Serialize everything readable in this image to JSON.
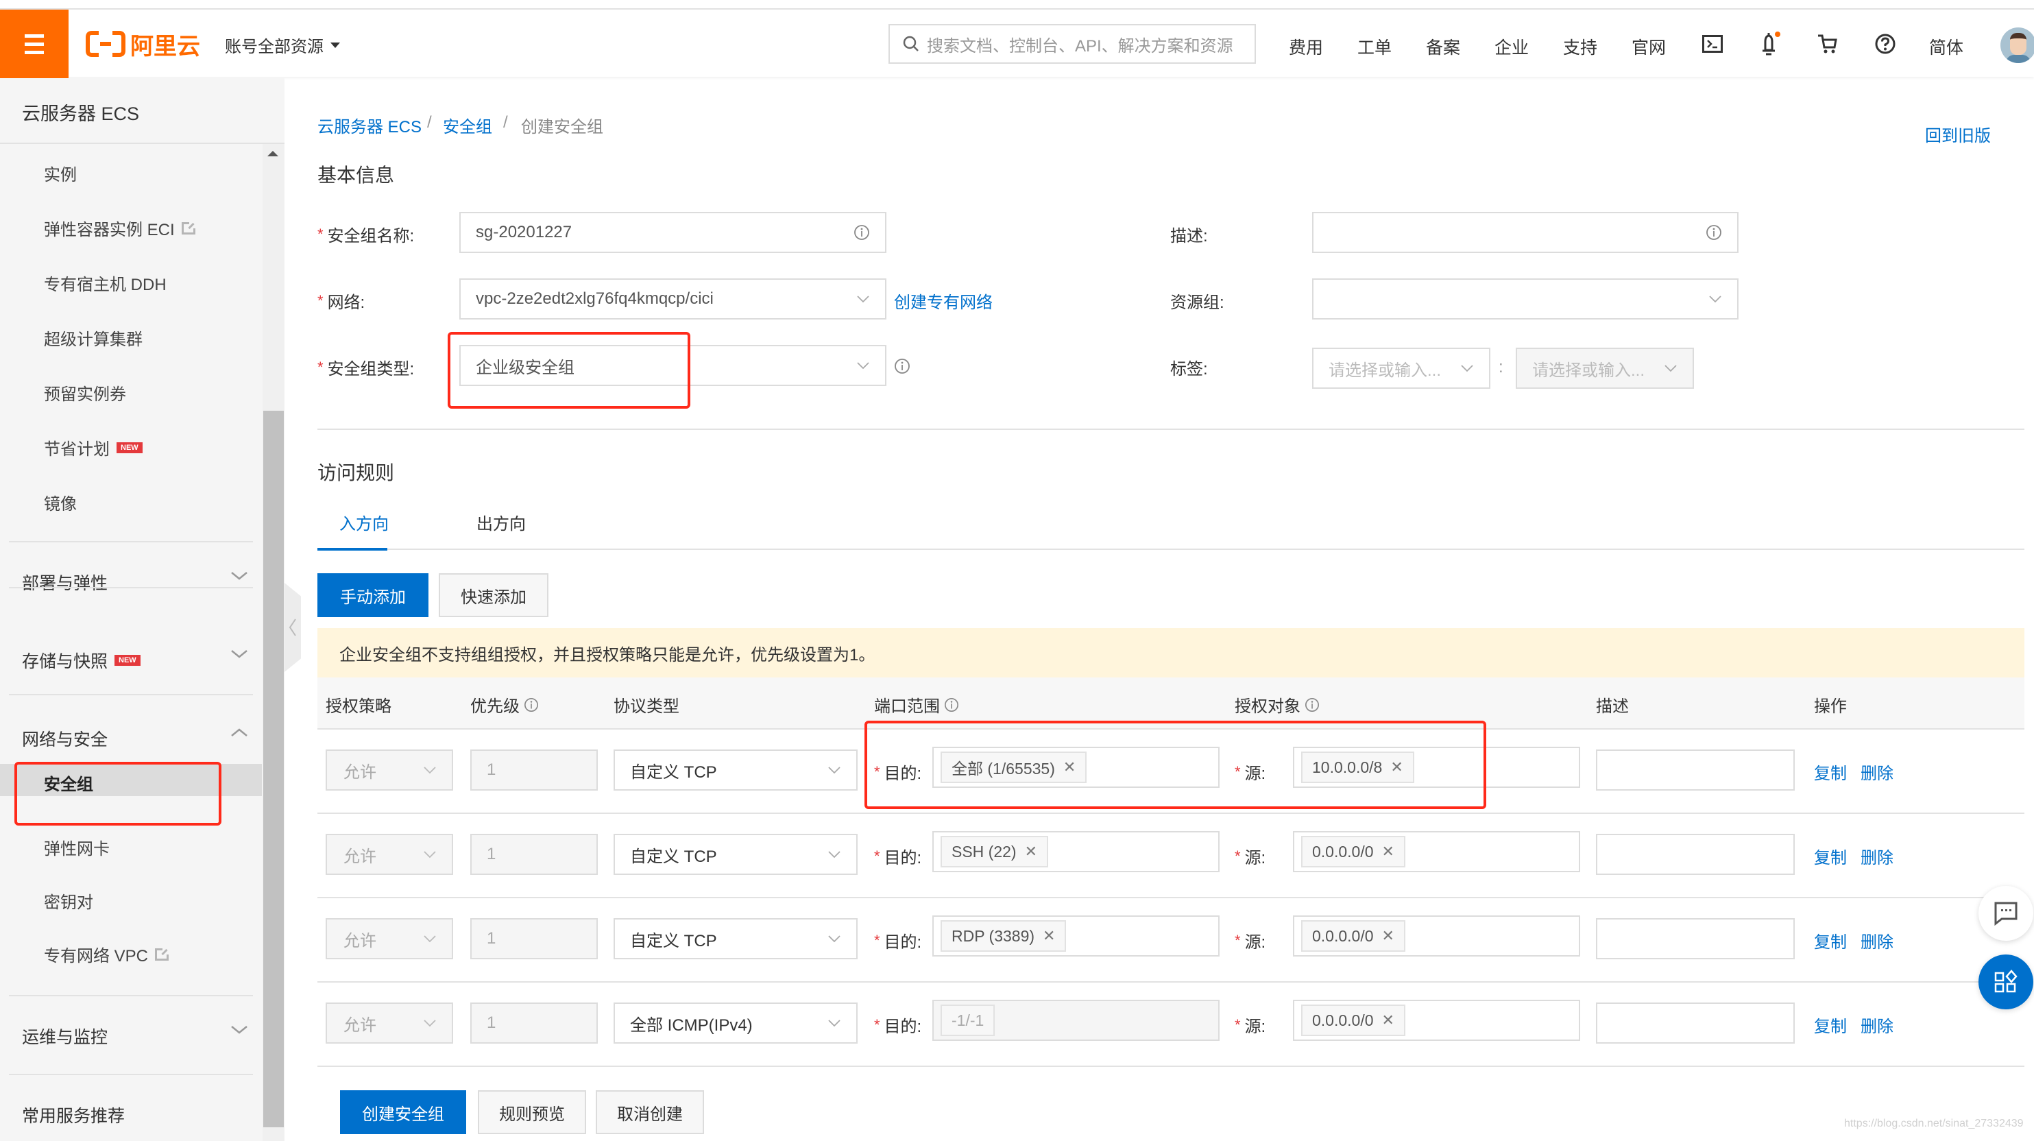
{
  "topbar": {
    "brand": "阿里云",
    "account_label": "账号全部资源",
    "search_placeholder": "搜索文档、控制台、API、解决方案和资源",
    "nav": [
      "费用",
      "工单",
      "备案",
      "企业",
      "支持",
      "官网"
    ],
    "icons": [
      "terminal-icon",
      "bell-icon",
      "cart-icon",
      "help-icon"
    ],
    "language": "简体",
    "brand_color": "#ff6a00"
  },
  "sidebar": {
    "title": "云服务器 ECS",
    "items_top": [
      {
        "label": "实例"
      },
      {
        "label": "弹性容器实例 ECI",
        "external": true
      },
      {
        "label": "专有宿主机 DDH"
      },
      {
        "label": "超级计算集群"
      },
      {
        "label": "预留实例券"
      },
      {
        "label": "节省计划",
        "badge": "NEW"
      },
      {
        "label": "镜像"
      }
    ],
    "groups": [
      {
        "label": "部署与弹性",
        "expanded": false
      },
      {
        "label": "存储与快照",
        "badge": "NEW",
        "expanded": false
      },
      {
        "label": "网络与安全",
        "expanded": true,
        "items": [
          {
            "label": "安全组",
            "active": true
          },
          {
            "label": "弹性网卡"
          },
          {
            "label": "密钥对"
          },
          {
            "label": "专有网络 VPC",
            "external": true
          }
        ]
      },
      {
        "label": "运维与监控",
        "expanded": false
      },
      {
        "label": "常用服务推荐"
      }
    ]
  },
  "breadcrumb": [
    "云服务器 ECS",
    "安全组",
    "创建安全组"
  ],
  "back_to_old": "回到旧版",
  "basic_info": {
    "title": "基本信息",
    "name_label": "安全组名称:",
    "name_value": "sg-20201227",
    "network_label": "网络:",
    "network_value": "vpc-2ze2edt2xlg76fq4kmqcp/cici",
    "create_vpc_link": "创建专有网络",
    "type_label": "安全组类型:",
    "type_value": "企业级安全组",
    "desc_label": "描述:",
    "desc_value": "",
    "resource_group_label": "资源组:",
    "resource_group_value": "",
    "tag_label": "标签:",
    "tag_key_placeholder": "请选择或输入...",
    "tag_value_placeholder": "请选择或输入...",
    "tag_sep": ":"
  },
  "rules": {
    "title": "访问规则",
    "tabs": [
      {
        "label": "入方向",
        "active": true
      },
      {
        "label": "出方向",
        "active": false
      }
    ],
    "add_manual": "手动添加",
    "add_quick": "快速添加",
    "notice": "企业安全组不支持组组授权，并且授权策略只能是允许，优先级设置为1。",
    "columns": [
      "授权策略",
      "优先级",
      "协议类型",
      "端口范围",
      "授权对象",
      "描述",
      "操作"
    ],
    "dest_label": "目的:",
    "src_label": "源:",
    "copy_label": "复制",
    "delete_label": "删除",
    "rows": [
      {
        "policy": "允许",
        "priority": "1",
        "protocol": "自定义 TCP",
        "port": "全部 (1/65535)",
        "port_disabled": false,
        "source": "10.0.0.0/8",
        "description": ""
      },
      {
        "policy": "允许",
        "priority": "1",
        "protocol": "自定义 TCP",
        "port": "SSH (22)",
        "port_disabled": false,
        "source": "0.0.0.0/0",
        "description": ""
      },
      {
        "policy": "允许",
        "priority": "1",
        "protocol": "自定义 TCP",
        "port": "RDP (3389)",
        "port_disabled": false,
        "source": "0.0.0.0/0",
        "description": ""
      },
      {
        "policy": "允许",
        "priority": "1",
        "protocol": "全部 ICMP(IPv4)",
        "port": "-1/-1",
        "port_disabled": true,
        "source": "0.0.0.0/0",
        "description": ""
      }
    ]
  },
  "footer_buttons": {
    "create": "创建安全组",
    "preview": "规则预览",
    "cancel": "取消创建"
  },
  "accent_color": "#0070cc",
  "watermark": "https://blog.csdn.net/sinat_27332439"
}
